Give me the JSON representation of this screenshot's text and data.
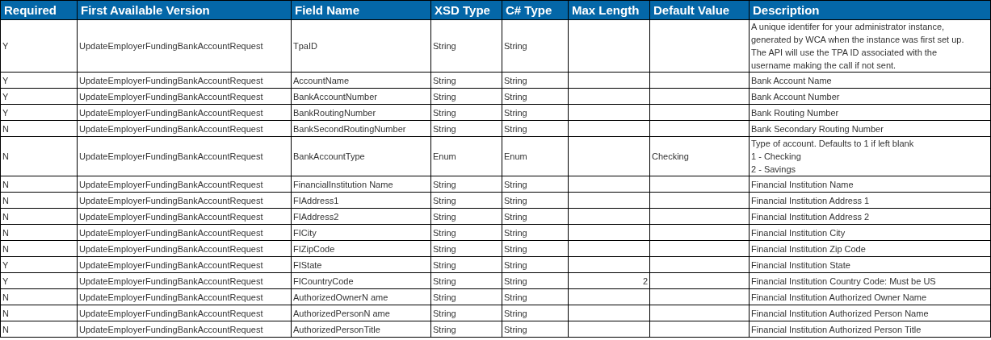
{
  "table": {
    "columns": [
      "Required",
      "First Available Version",
      "Field Name",
      "XSD Type",
      "C# Type",
      "Max Length",
      "Default Value",
      "Description"
    ],
    "rows": [
      {
        "required": "Y",
        "version": "UpdateEmployerFundingBankAccountRequest",
        "field": "TpaID",
        "xsd_type": "String",
        "cs_type": "String",
        "description": "A unique identifer for your administrator instance,\ngenerated by WCA when the instance was first set up.\nThe API will use the TPA ID associated with the\nusername making the call if not sent."
      },
      {
        "required": "Y",
        "version": "UpdateEmployerFundingBankAccountRequest",
        "field": "AccountName",
        "xsd_type": "String",
        "cs_type": "String",
        "description": "Bank Account Name"
      },
      {
        "required": "Y",
        "version": "UpdateEmployerFundingBankAccountRequest",
        "field": "BankAccountNumber",
        "xsd_type": "String",
        "cs_type": "String",
        "description": "Bank Account Number"
      },
      {
        "required": "Y",
        "version": "UpdateEmployerFundingBankAccountRequest",
        "field": "BankRoutingNumber",
        "xsd_type": "String",
        "cs_type": "String",
        "description": "Bank Routing Number"
      },
      {
        "required": "N",
        "version": "UpdateEmployerFundingBankAccountRequest",
        "field": "BankSecondRoutingNumber",
        "xsd_type": "String",
        "cs_type": "String",
        "description": "Bank Secondary Routing Number"
      },
      {
        "required": "N",
        "version": "UpdateEmployerFundingBankAccountRequest",
        "field": "BankAccountType",
        "xsd_type": "Enum",
        "cs_type": "Enum",
        "default_value": "Checking",
        "description": "Type of account. Defaults to 1 if left blank\n1 - Checking\n2 - Savings"
      },
      {
        "required": "N",
        "version": "UpdateEmployerFundingBankAccountRequest",
        "field": "FinancialInstitution Name",
        "xsd_type": "String",
        "cs_type": "String",
        "description": "Financial Institution Name"
      },
      {
        "required": "N",
        "version": "UpdateEmployerFundingBankAccountRequest",
        "field": "FIAddress1",
        "xsd_type": "String",
        "cs_type": "String",
        "description": "Financial Institution Address 1"
      },
      {
        "required": "N",
        "version": "UpdateEmployerFundingBankAccountRequest",
        "field": "FIAddress2",
        "xsd_type": "String",
        "cs_type": "String",
        "description": "Financial Institution Address 2"
      },
      {
        "required": "N",
        "version": "UpdateEmployerFundingBankAccountRequest",
        "field": "FICity",
        "xsd_type": "String",
        "cs_type": "String",
        "description": "Financial Institution City"
      },
      {
        "required": "N",
        "version": "UpdateEmployerFundingBankAccountRequest",
        "field": "FIZipCode",
        "xsd_type": "String",
        "cs_type": "String",
        "description": "Financial Institution Zip Code"
      },
      {
        "required": "Y",
        "version": "UpdateEmployerFundingBankAccountRequest",
        "field": "FIState",
        "xsd_type": "String",
        "cs_type": "String",
        "description": "Financial Institution State"
      },
      {
        "required": "Y",
        "version": "UpdateEmployerFundingBankAccountRequest",
        "field": "FICountryCode",
        "xsd_type": "String",
        "cs_type": "String",
        "max_length": "2",
        "description": "Financial Institution Country Code: Must be US"
      },
      {
        "required": "N",
        "version": "UpdateEmployerFundingBankAccountRequest",
        "field": "AuthorizedOwnerN ame",
        "xsd_type": "String",
        "cs_type": "String",
        "description": "Financial Institution Authorized Owner Name"
      },
      {
        "required": "N",
        "version": "UpdateEmployerFundingBankAccountRequest",
        "field": "AuthorizedPersonN ame",
        "xsd_type": "String",
        "cs_type": "String",
        "description": "Financial Institution Authorized Person Name"
      },
      {
        "required": "N",
        "version": "UpdateEmployerFundingBankAccountRequest",
        "field": "AuthorizedPersonTitle",
        "xsd_type": "String",
        "cs_type": "String",
        "description": "Financial Institution Authorized Person Title"
      }
    ]
  }
}
